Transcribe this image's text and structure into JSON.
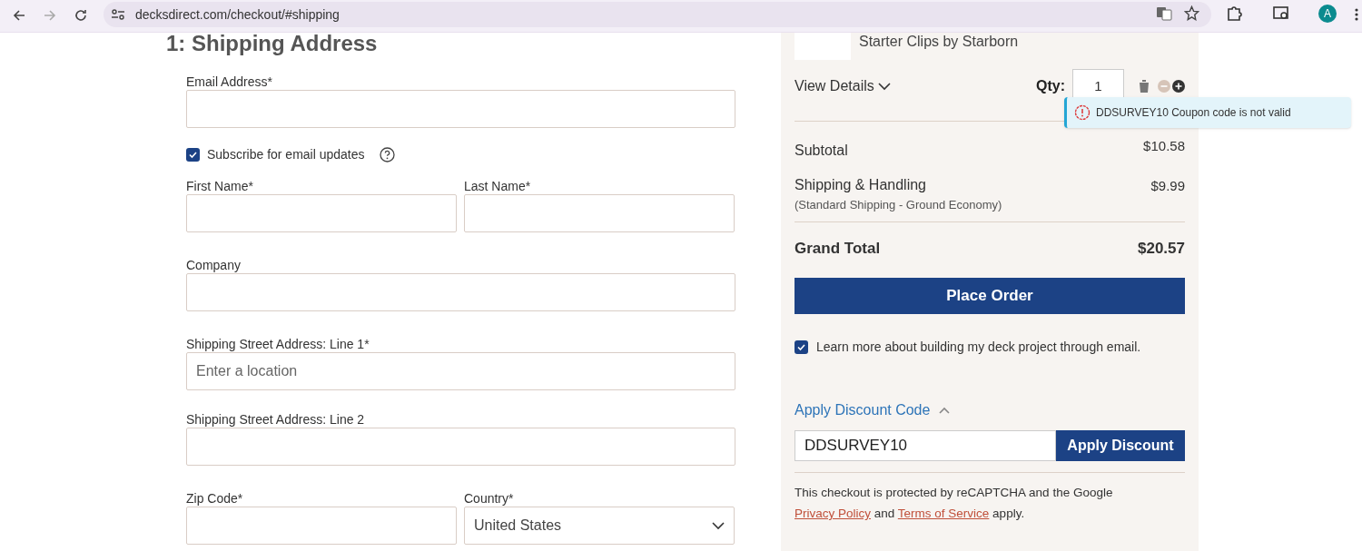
{
  "browser": {
    "url": "decksdirect.com/checkout/#shipping",
    "profile_initial": "A"
  },
  "shipping": {
    "heading": "1: Shipping Address",
    "fields": [
      {
        "kind": "full",
        "label": "Email Address*"
      },
      {
        "kind": "checkbox",
        "label": "Subscribe for email updates",
        "checked": true
      },
      {
        "kind": "pair",
        "items": [
          {
            "label": "First Name*"
          },
          {
            "label": "Last Name*"
          }
        ]
      },
      {
        "kind": "full",
        "label": "Company"
      },
      {
        "kind": "full",
        "label": "Shipping Street Address: Line 1*",
        "placeholder": "Enter a location"
      },
      {
        "kind": "full",
        "label": "Shipping Street Address: Line 2"
      },
      {
        "kind": "pair",
        "items": [
          {
            "label": "Zip Code*"
          },
          {
            "label": "Country*",
            "select": "United States"
          }
        ]
      }
    ]
  },
  "summary": {
    "product": "Starter Clips by Starborn",
    "view_details": "View Details",
    "qty_label": "Qty:",
    "qty": "1",
    "toast": "DDSURVEY10 Coupon code is not valid",
    "subtotal": {
      "label": "Subtotal",
      "value": "$10.58"
    },
    "shipping": {
      "label": "Shipping & Handling",
      "note": "(Standard Shipping - Ground Economy)",
      "value": "$9.99"
    },
    "grand_total": {
      "label": "Grand Total",
      "value": "$20.57"
    },
    "place_order": "Place Order",
    "learn_more": {
      "label": "Learn more about building my deck project through email.",
      "checked": true
    },
    "discount": {
      "toggle": "Apply Discount Code",
      "expanded": true,
      "value": "DDSURVEY10",
      "button": "Apply Discount"
    },
    "recaptcha": {
      "before": "This checkout is protected by reCAPTCHA and the Google ",
      "link1": "Privacy Policy",
      "middle": " and ",
      "link2": "Terms of Service",
      "after": " apply."
    }
  }
}
